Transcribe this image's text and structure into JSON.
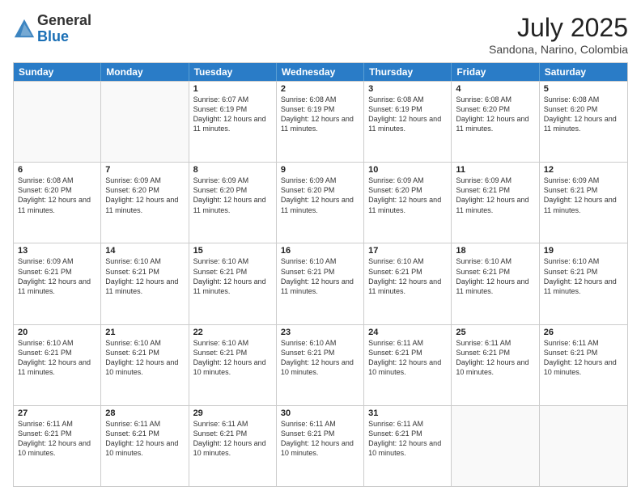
{
  "header": {
    "logo_general": "General",
    "logo_blue": "Blue",
    "month_year": "July 2025",
    "location": "Sandona, Narino, Colombia"
  },
  "days_of_week": [
    "Sunday",
    "Monday",
    "Tuesday",
    "Wednesday",
    "Thursday",
    "Friday",
    "Saturday"
  ],
  "weeks": [
    [
      {
        "day": "",
        "empty": true
      },
      {
        "day": "",
        "empty": true
      },
      {
        "day": "1",
        "sunrise": "6:07 AM",
        "sunset": "6:19 PM",
        "daylight": "12 hours and 11 minutes."
      },
      {
        "day": "2",
        "sunrise": "6:08 AM",
        "sunset": "6:19 PM",
        "daylight": "12 hours and 11 minutes."
      },
      {
        "day": "3",
        "sunrise": "6:08 AM",
        "sunset": "6:19 PM",
        "daylight": "12 hours and 11 minutes."
      },
      {
        "day": "4",
        "sunrise": "6:08 AM",
        "sunset": "6:20 PM",
        "daylight": "12 hours and 11 minutes."
      },
      {
        "day": "5",
        "sunrise": "6:08 AM",
        "sunset": "6:20 PM",
        "daylight": "12 hours and 11 minutes."
      }
    ],
    [
      {
        "day": "6",
        "sunrise": "6:08 AM",
        "sunset": "6:20 PM",
        "daylight": "12 hours and 11 minutes."
      },
      {
        "day": "7",
        "sunrise": "6:09 AM",
        "sunset": "6:20 PM",
        "daylight": "12 hours and 11 minutes."
      },
      {
        "day": "8",
        "sunrise": "6:09 AM",
        "sunset": "6:20 PM",
        "daylight": "12 hours and 11 minutes."
      },
      {
        "day": "9",
        "sunrise": "6:09 AM",
        "sunset": "6:20 PM",
        "daylight": "12 hours and 11 minutes."
      },
      {
        "day": "10",
        "sunrise": "6:09 AM",
        "sunset": "6:20 PM",
        "daylight": "12 hours and 11 minutes."
      },
      {
        "day": "11",
        "sunrise": "6:09 AM",
        "sunset": "6:21 PM",
        "daylight": "12 hours and 11 minutes."
      },
      {
        "day": "12",
        "sunrise": "6:09 AM",
        "sunset": "6:21 PM",
        "daylight": "12 hours and 11 minutes."
      }
    ],
    [
      {
        "day": "13",
        "sunrise": "6:09 AM",
        "sunset": "6:21 PM",
        "daylight": "12 hours and 11 minutes."
      },
      {
        "day": "14",
        "sunrise": "6:10 AM",
        "sunset": "6:21 PM",
        "daylight": "12 hours and 11 minutes."
      },
      {
        "day": "15",
        "sunrise": "6:10 AM",
        "sunset": "6:21 PM",
        "daylight": "12 hours and 11 minutes."
      },
      {
        "day": "16",
        "sunrise": "6:10 AM",
        "sunset": "6:21 PM",
        "daylight": "12 hours and 11 minutes."
      },
      {
        "day": "17",
        "sunrise": "6:10 AM",
        "sunset": "6:21 PM",
        "daylight": "12 hours and 11 minutes."
      },
      {
        "day": "18",
        "sunrise": "6:10 AM",
        "sunset": "6:21 PM",
        "daylight": "12 hours and 11 minutes."
      },
      {
        "day": "19",
        "sunrise": "6:10 AM",
        "sunset": "6:21 PM",
        "daylight": "12 hours and 11 minutes."
      }
    ],
    [
      {
        "day": "20",
        "sunrise": "6:10 AM",
        "sunset": "6:21 PM",
        "daylight": "12 hours and 11 minutes."
      },
      {
        "day": "21",
        "sunrise": "6:10 AM",
        "sunset": "6:21 PM",
        "daylight": "12 hours and 10 minutes."
      },
      {
        "day": "22",
        "sunrise": "6:10 AM",
        "sunset": "6:21 PM",
        "daylight": "12 hours and 10 minutes."
      },
      {
        "day": "23",
        "sunrise": "6:10 AM",
        "sunset": "6:21 PM",
        "daylight": "12 hours and 10 minutes."
      },
      {
        "day": "24",
        "sunrise": "6:11 AM",
        "sunset": "6:21 PM",
        "daylight": "12 hours and 10 minutes."
      },
      {
        "day": "25",
        "sunrise": "6:11 AM",
        "sunset": "6:21 PM",
        "daylight": "12 hours and 10 minutes."
      },
      {
        "day": "26",
        "sunrise": "6:11 AM",
        "sunset": "6:21 PM",
        "daylight": "12 hours and 10 minutes."
      }
    ],
    [
      {
        "day": "27",
        "sunrise": "6:11 AM",
        "sunset": "6:21 PM",
        "daylight": "12 hours and 10 minutes."
      },
      {
        "day": "28",
        "sunrise": "6:11 AM",
        "sunset": "6:21 PM",
        "daylight": "12 hours and 10 minutes."
      },
      {
        "day": "29",
        "sunrise": "6:11 AM",
        "sunset": "6:21 PM",
        "daylight": "12 hours and 10 minutes."
      },
      {
        "day": "30",
        "sunrise": "6:11 AM",
        "sunset": "6:21 PM",
        "daylight": "12 hours and 10 minutes."
      },
      {
        "day": "31",
        "sunrise": "6:11 AM",
        "sunset": "6:21 PM",
        "daylight": "12 hours and 10 minutes."
      },
      {
        "day": "",
        "empty": true
      },
      {
        "day": "",
        "empty": true
      }
    ]
  ]
}
